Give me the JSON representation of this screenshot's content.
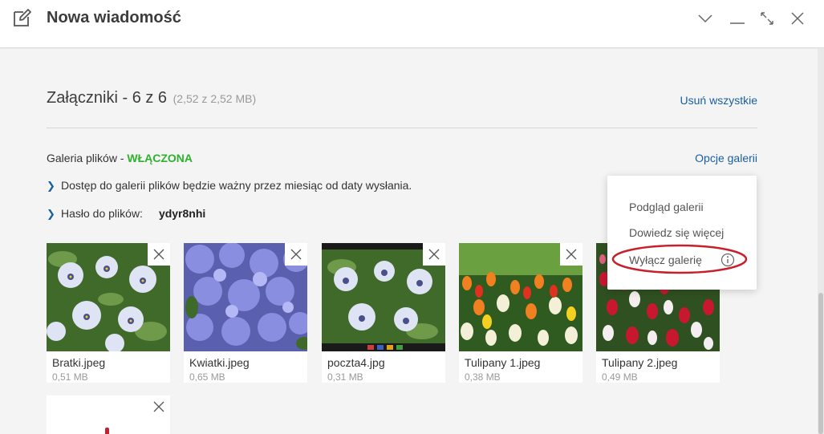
{
  "window": {
    "title": "Nowa wiadomość",
    "icons": [
      "compose-icon",
      "chevron-down-icon",
      "minimize-icon",
      "expand-icon",
      "close-icon"
    ]
  },
  "attachments": {
    "header": "Załączniki - 6 z 6",
    "size_info": "(2,52 z 2,52 MB)",
    "remove_all": "Usuń wszystkie"
  },
  "gallery": {
    "label": "Galeria plików -",
    "status": "WŁĄCZONA",
    "status_color": "#2fb02f",
    "options_link": "Opcje galerii",
    "info_access": "Dostęp do galerii plików będzie ważny przez miesiąc od daty wysłania.",
    "password_label": "Hasło do plików:",
    "password_value": "ydyr8nhi"
  },
  "menu": {
    "items": [
      "Podgląd galerii",
      "Dowiedz się więcej",
      "Wyłącz galerię"
    ],
    "highlight_color": "#c8202a"
  },
  "files": [
    {
      "name": "Bratki.jpeg",
      "size": "0,51 MB"
    },
    {
      "name": "Kwiatki.jpeg",
      "size": "0,65 MB"
    },
    {
      "name": "poczta4.jpg",
      "size": "0,31 MB"
    },
    {
      "name": "Tulipany 1.jpeg",
      "size": "0,38 MB"
    },
    {
      "name": "Tulipany 2.jpeg",
      "size": "0,49 MB"
    }
  ],
  "colors": {
    "link": "#1a5fa0",
    "background": "#f4f4f4"
  }
}
